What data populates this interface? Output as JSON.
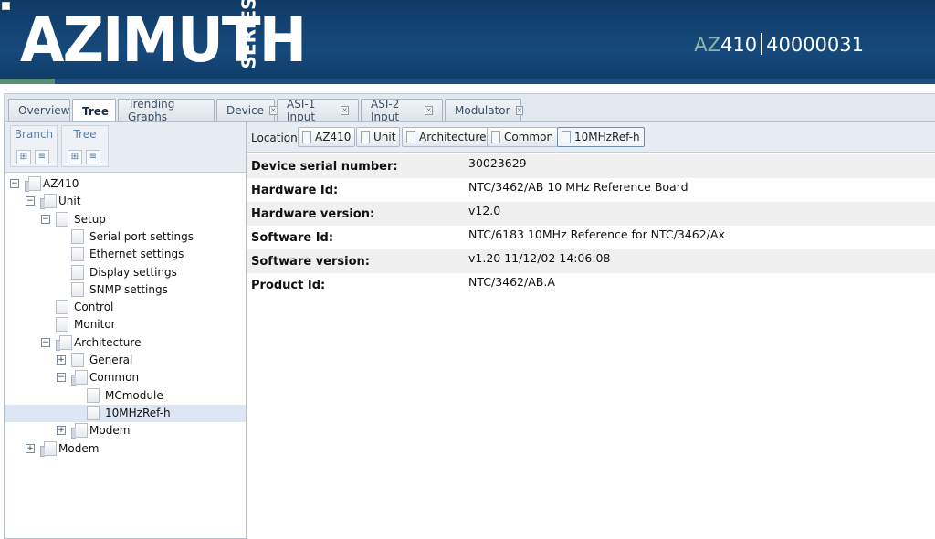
{
  "header": {
    "logo_text": "AZIMUTH",
    "logo_series": "SERIES",
    "model_prefix": "AZ",
    "model_rest": "410",
    "serial": "40000031"
  },
  "tabs": [
    {
      "label": "Overview",
      "closable": false,
      "active": false
    },
    {
      "label": "Tree",
      "closable": false,
      "active": true
    },
    {
      "label": "Trending Graphs",
      "closable": false,
      "active": false
    },
    {
      "label": "Device",
      "closable": true,
      "active": false
    },
    {
      "label": "ASI-1 Input",
      "closable": true,
      "active": false
    },
    {
      "label": "ASI-2 Input",
      "closable": true,
      "active": false
    },
    {
      "label": "Modulator",
      "closable": true,
      "active": false
    }
  ],
  "toolbar": {
    "branch_label": "Branch",
    "tree_label": "Tree"
  },
  "tree": [
    {
      "label": "AZ410",
      "depth": 0,
      "expander": "minus",
      "folder": true,
      "selected": false
    },
    {
      "label": "Unit",
      "depth": 1,
      "expander": "minus",
      "folder": true,
      "selected": false
    },
    {
      "label": "Setup",
      "depth": 2,
      "expander": "minus",
      "folder": false,
      "selected": false
    },
    {
      "label": "Serial port settings",
      "depth": 3,
      "expander": "none",
      "folder": false,
      "selected": false
    },
    {
      "label": "Ethernet settings",
      "depth": 3,
      "expander": "none",
      "folder": false,
      "selected": false
    },
    {
      "label": "Display settings",
      "depth": 3,
      "expander": "none",
      "folder": false,
      "selected": false
    },
    {
      "label": "SNMP settings",
      "depth": 3,
      "expander": "none",
      "folder": false,
      "selected": false
    },
    {
      "label": "Control",
      "depth": 2,
      "expander": "none",
      "folder": false,
      "selected": false
    },
    {
      "label": "Monitor",
      "depth": 2,
      "expander": "none",
      "folder": false,
      "selected": false
    },
    {
      "label": "Architecture",
      "depth": 2,
      "expander": "minus",
      "folder": true,
      "selected": false
    },
    {
      "label": "General",
      "depth": 3,
      "expander": "plus",
      "folder": false,
      "selected": false
    },
    {
      "label": "Common",
      "depth": 3,
      "expander": "minus",
      "folder": true,
      "selected": false
    },
    {
      "label": "MCmodule",
      "depth": 4,
      "expander": "none",
      "folder": false,
      "selected": false
    },
    {
      "label": "10MHzRef-h",
      "depth": 4,
      "expander": "none",
      "folder": false,
      "selected": true
    },
    {
      "label": "Modem",
      "depth": 3,
      "expander": "plus",
      "folder": true,
      "selected": false
    },
    {
      "label": "Modem",
      "depth": 1,
      "expander": "plus",
      "folder": true,
      "selected": false
    }
  ],
  "location": {
    "label": "Location:",
    "crumbs": [
      "AZ410",
      "Unit",
      "Architecture",
      "Common",
      "10MHzRef-h"
    ]
  },
  "properties": [
    {
      "key": "Device serial number:",
      "value": "30023629"
    },
    {
      "key": "Hardware Id:",
      "value": "NTC/3462/AB 10 MHz Reference Board"
    },
    {
      "key": "Hardware version:",
      "value": "v12.0"
    },
    {
      "key": "Software Id:",
      "value": "NTC/6183 10MHz Reference for NTC/3462/Ax"
    },
    {
      "key": "Software version:",
      "value": "v1.20  11/12/02 14:06:08"
    },
    {
      "key": "Product Id:",
      "value": "NTC/3462/AB.A"
    }
  ]
}
